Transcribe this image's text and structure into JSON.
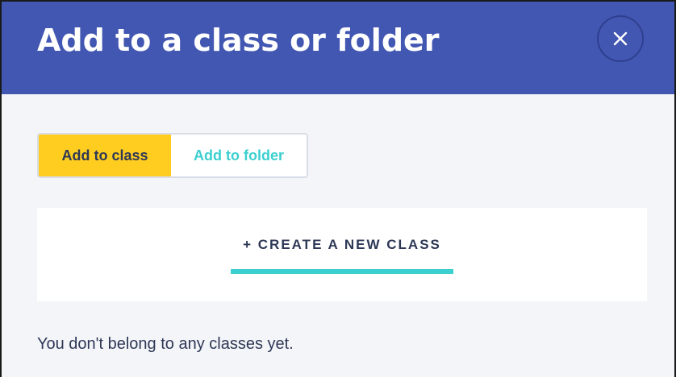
{
  "modal": {
    "title": "Add to a class or folder",
    "close_icon": "close-icon"
  },
  "tabs": {
    "items": [
      {
        "label": "Add to class",
        "active": true
      },
      {
        "label": "Add to folder",
        "active": false
      }
    ]
  },
  "create": {
    "label": "+ CREATE A NEW CLASS"
  },
  "empty_state": {
    "text": "You don't belong to any classes yet."
  },
  "colors": {
    "header": "#4257b2",
    "accent_yellow": "#ffcd1f",
    "accent_teal": "#3ccfcf",
    "text_dark": "#2e3856",
    "body_bg": "#f4f5f9"
  }
}
